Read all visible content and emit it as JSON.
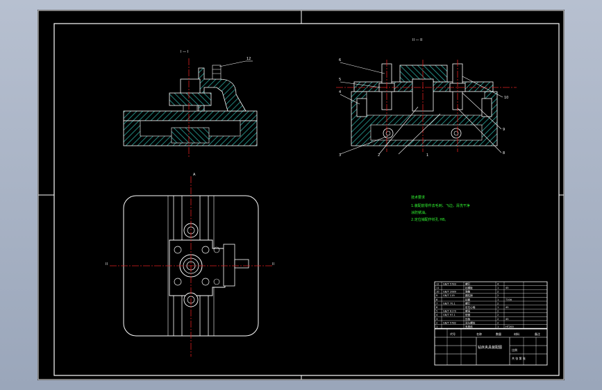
{
  "colors": {
    "background": "#000000",
    "frame": "#ffffff",
    "hatch": "#2aa9a0",
    "centerline": "#e02020",
    "notes": "#33ff33",
    "part": "#cfcfcf"
  },
  "views": {
    "front_view_label": "I — I",
    "side_view_label": "II — II"
  },
  "callouts": {
    "front": [
      "12"
    ],
    "side_left": [
      "6",
      "5",
      "4",
      "3",
      "2"
    ],
    "side_right": [
      "10",
      "9",
      "8",
      "1"
    ]
  },
  "section_marks": {
    "top": "A",
    "left": "II",
    "right": "II"
  },
  "notes": {
    "heading": "技术要求",
    "line1": "1.装配前零件去毛刺、飞边，清洗干净",
    "line2": "涂防锈油。",
    "line3": "2.定位销配作铰孔 H8。"
  },
  "title_block": {
    "drawing_title": "钻床夹具装配图",
    "scale_label": "比例",
    "sheet_label": "共 张 第 张",
    "code_label": "代号",
    "name_label": "名称",
    "qty_label": "数量",
    "material_label": "材料",
    "remark_label": "备注"
  },
  "bom_rows": [
    [
      "12",
      "GB/T 5783",
      "螺钉",
      "4",
      ""
    ],
    [
      "11",
      "",
      "钻模板",
      "1",
      "45"
    ],
    [
      "10",
      "GB/T 2089",
      "弹簧",
      "2",
      ""
    ],
    [
      "9",
      "GB/T 119",
      "圆柱销",
      "2",
      ""
    ],
    [
      "8",
      "",
      "钻套",
      "1",
      "T10A"
    ],
    [
      "7",
      "GB/T 70.1",
      "螺钉",
      "2",
      ""
    ],
    [
      "6",
      "",
      "定位心轴",
      "1",
      "45"
    ],
    [
      "5",
      "GB/T 6170",
      "螺母",
      "2",
      ""
    ],
    [
      "4",
      "GB/T 97.1",
      "垫圈",
      "2",
      ""
    ],
    [
      "3",
      "",
      "压板",
      "2",
      "45"
    ],
    [
      "2",
      "GB/T 5782",
      "双头螺柱",
      "2",
      ""
    ],
    [
      "1",
      "",
      "夹具体",
      "1",
      "HT200"
    ]
  ]
}
